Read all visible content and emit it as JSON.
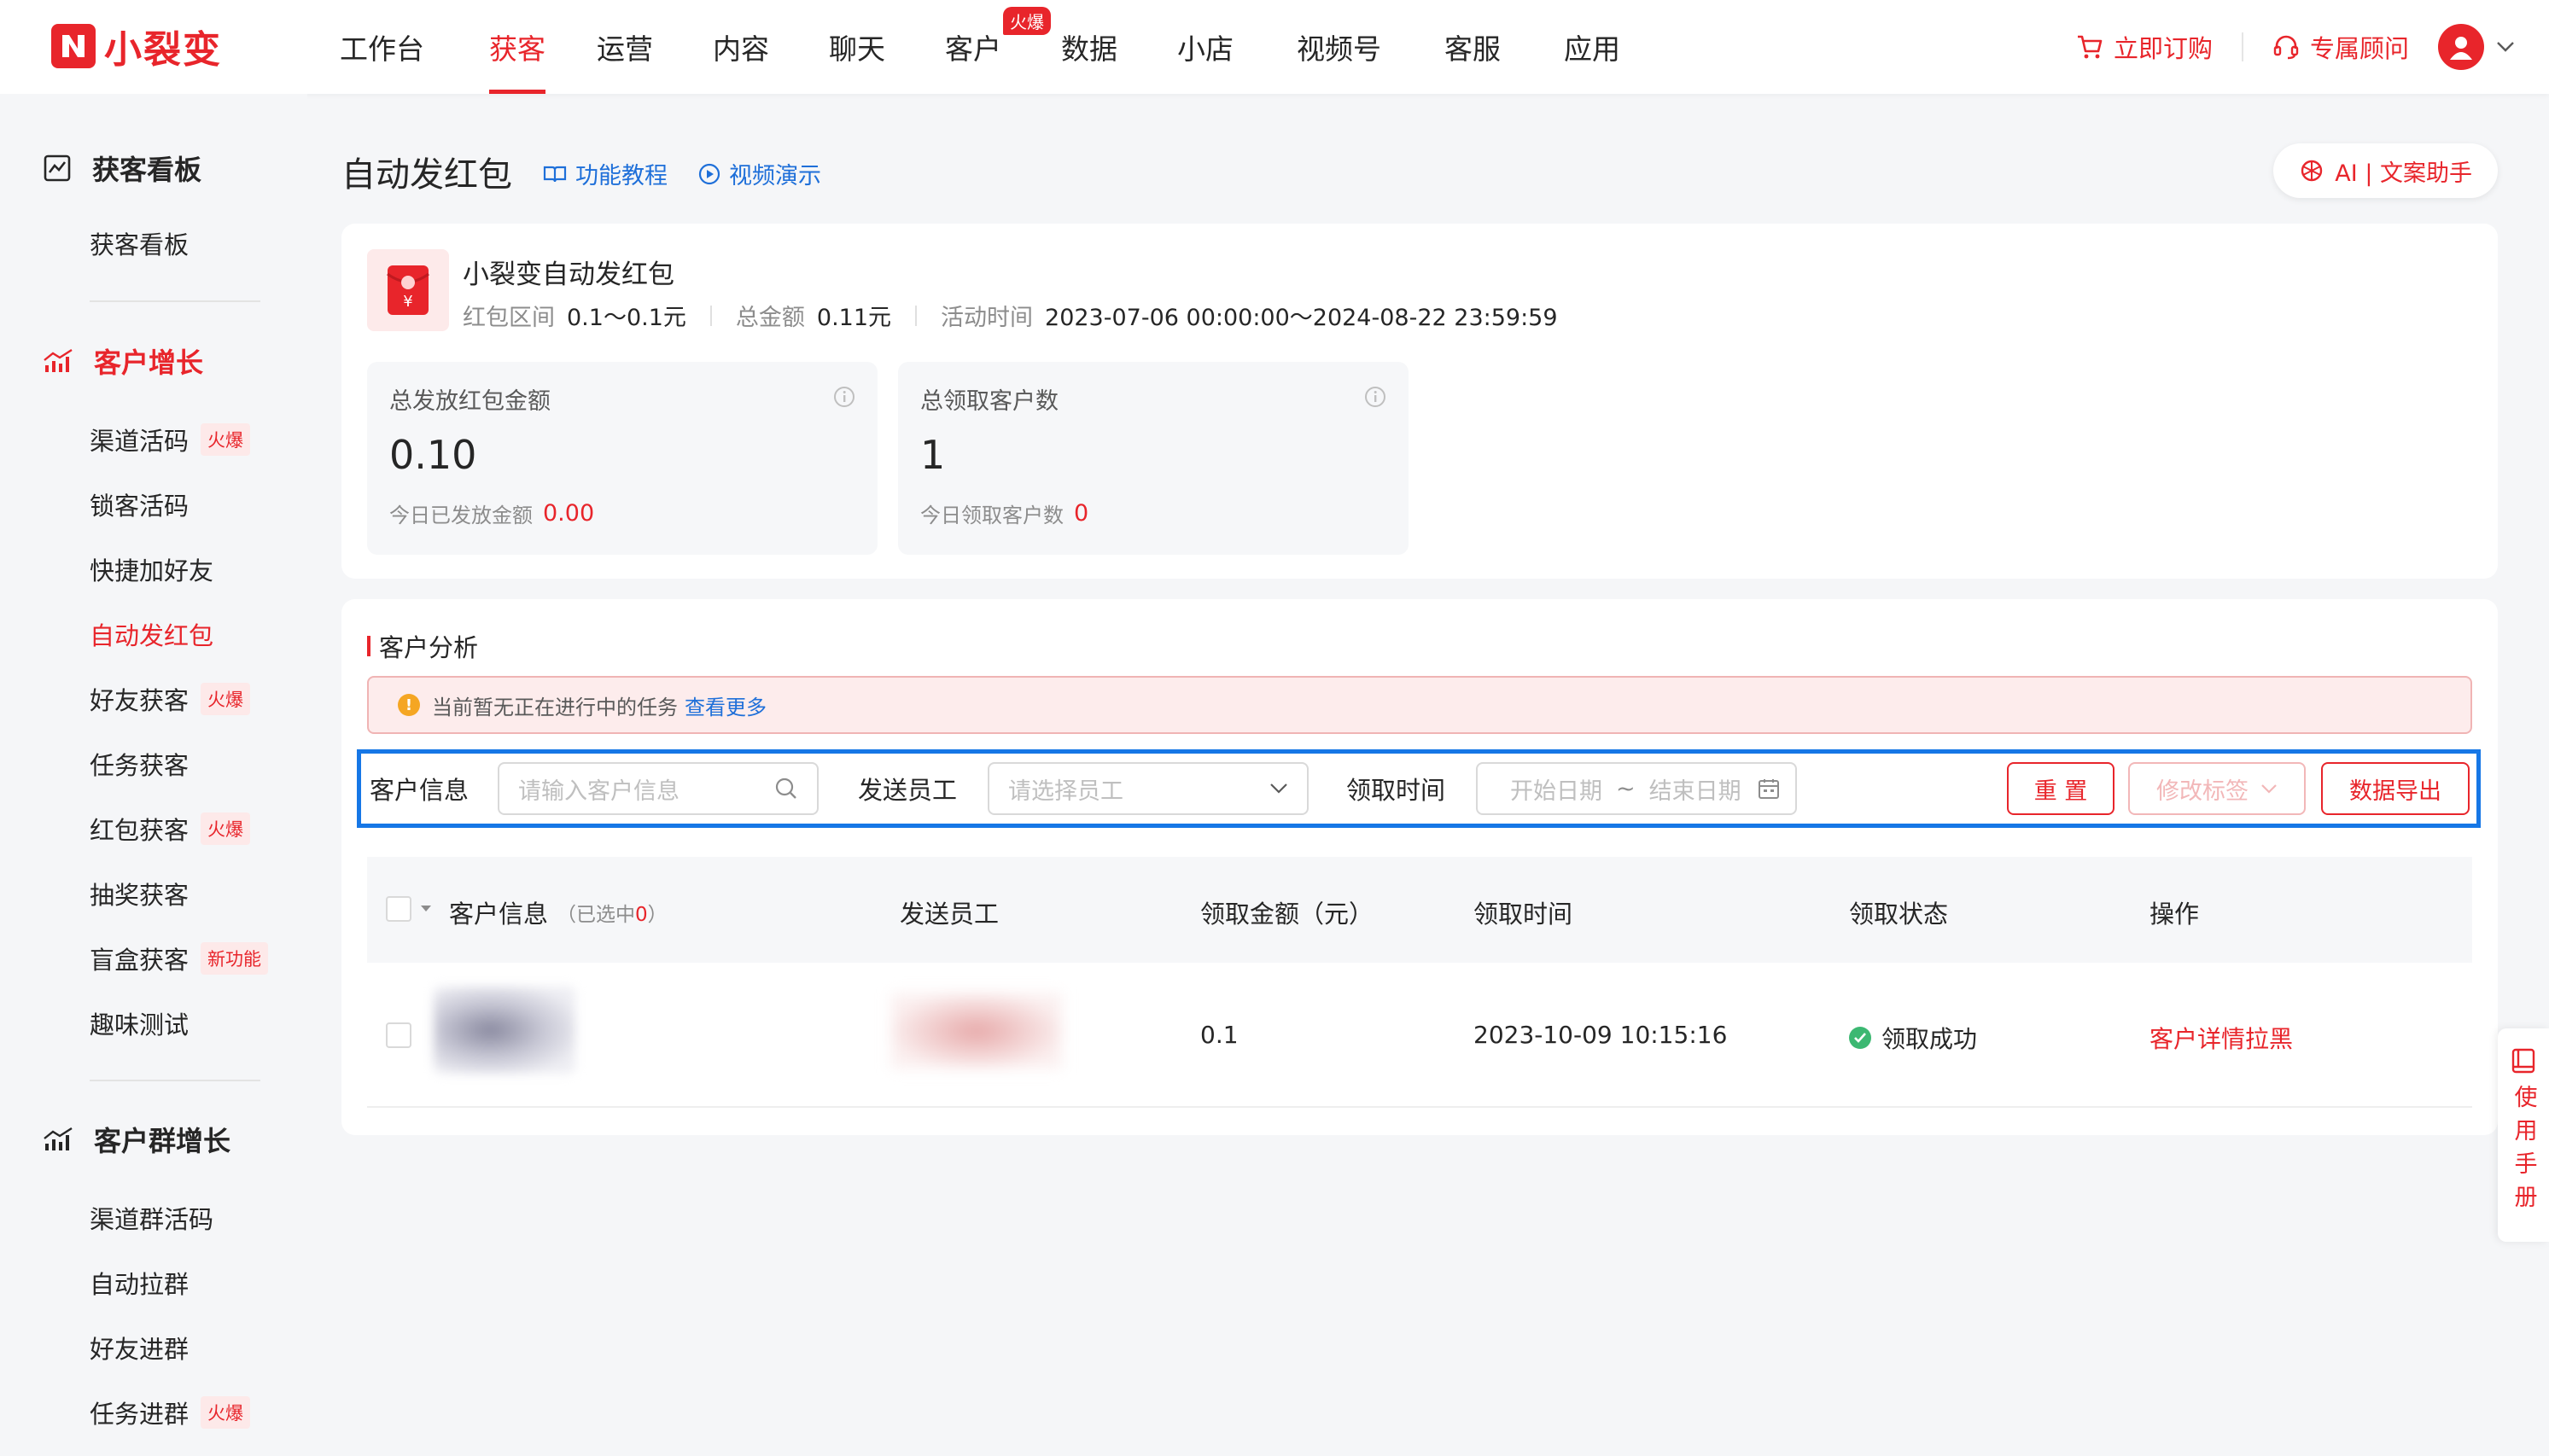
{
  "brand": {
    "name": "小裂变",
    "color": "#e8252b"
  },
  "nav": {
    "items": [
      "工作台",
      "获客",
      "运营",
      "内容",
      "聊天",
      "客户",
      "数据",
      "小店",
      "视频号",
      "客服",
      "应用"
    ],
    "active": "获客",
    "hot_badge": "火爆"
  },
  "topright": {
    "order": "立即订购",
    "advisor": "专属顾问"
  },
  "sidebar": {
    "group1": {
      "title": "获客看板",
      "items": [
        "获客看板"
      ]
    },
    "group2": {
      "title": "客户增长",
      "items": [
        {
          "label": "渠道活码",
          "tag": "火爆"
        },
        {
          "label": "锁客活码",
          "tag": ""
        },
        {
          "label": "快捷加好友",
          "tag": ""
        },
        {
          "label": "自动发红包",
          "tag": ""
        },
        {
          "label": "好友获客",
          "tag": "火爆"
        },
        {
          "label": "任务获客",
          "tag": ""
        },
        {
          "label": "红包获客",
          "tag": "火爆"
        },
        {
          "label": "抽奖获客",
          "tag": ""
        },
        {
          "label": "盲盒获客",
          "tag": "新功能"
        },
        {
          "label": "趣味测试",
          "tag": ""
        }
      ]
    },
    "group3": {
      "title": "客户群增长",
      "items": [
        {
          "label": "渠道群活码",
          "tag": ""
        },
        {
          "label": "自动拉群",
          "tag": ""
        },
        {
          "label": "好友进群",
          "tag": ""
        },
        {
          "label": "任务进群",
          "tag": "火爆"
        }
      ]
    }
  },
  "page": {
    "title": "自动发红包",
    "tutorial_link": "功能教程",
    "video_link": "视频演示",
    "ai_button": "AI | 文案助手"
  },
  "activity": {
    "name": "小裂变自动发红包",
    "range_label": "红包区间",
    "range_value": "0.1～0.1元",
    "total_label": "总金额",
    "total_value": "0.11元",
    "time_label": "活动时间",
    "time_value": "2023-07-06 00:00:00～2024-08-22 23:59:59"
  },
  "stats": [
    {
      "label": "总发放红包金额",
      "value": "0.10",
      "sub_label": "今日已发放金额",
      "sub_value": "0.00"
    },
    {
      "label": "总领取客户数",
      "value": "1",
      "sub_label": "今日领取客户数",
      "sub_value": "0"
    }
  ],
  "analysis": {
    "title": "客户分析",
    "alert_text": "当前暂无正在进行中的任务",
    "alert_link": "查看更多"
  },
  "filters": {
    "customer_label": "客户信息",
    "customer_placeholder": "请输入客户信息",
    "staff_label": "发送员工",
    "staff_placeholder": "请选择员工",
    "time_label": "领取时间",
    "start_placeholder": "开始日期",
    "range_sep": "~",
    "end_placeholder": "结束日期",
    "reset": "重 置",
    "modify_tag": "修改标签",
    "export": "数据导出"
  },
  "table": {
    "columns": [
      "客户信息",
      "发送员工",
      "领取金额（元）",
      "领取时间",
      "领取状态",
      "操作"
    ],
    "selected_prefix": "（已选中",
    "selected_count": "0",
    "selected_suffix": "）",
    "rows": [
      {
        "amount": "0.1",
        "time": "2023-10-09 10:15:16",
        "status": "领取成功",
        "ops": "客户详情拉黑"
      }
    ]
  },
  "manual": {
    "label": "使用手册"
  }
}
